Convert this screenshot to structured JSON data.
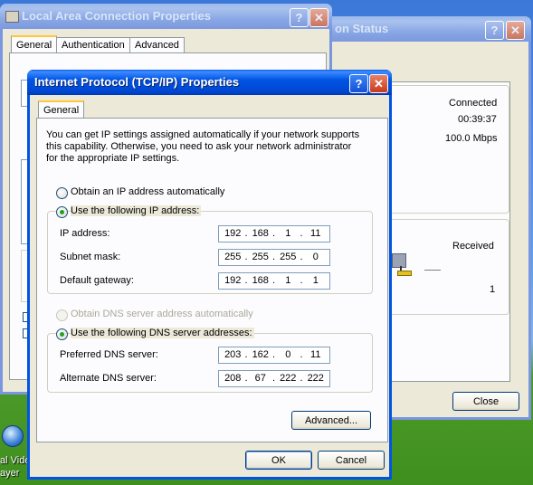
{
  "desktop": {
    "icon_label_1": "al Video",
    "icon_label_2": "ayer"
  },
  "status_window": {
    "title": "on Status",
    "help": "?",
    "close": "✕",
    "connected": "Connected",
    "duration": "00:39:37",
    "speed": "100.0 Mbps",
    "received_label": "Received",
    "received_count": "1",
    "close_button": "Close"
  },
  "lan_window": {
    "title": "Local Area Connection Properties",
    "help": "?",
    "close": "✕",
    "tabs": [
      "General",
      "Authentication",
      "Advanced"
    ]
  },
  "tcp_dialog": {
    "title": "Internet Protocol (TCP/IP) Properties",
    "help": "?",
    "close": "✕",
    "tab": "General",
    "intro": "You can get IP settings assigned automatically if your network supports this capability. Otherwise, you need to ask your network administrator for the appropriate IP settings.",
    "radio_auto_ip": "Obtain an IP address automatically",
    "radio_static_ip": "Use the following IP address:",
    "ip_label": "IP address:",
    "ip": [
      "192",
      "168",
      "1",
      "11"
    ],
    "mask_label": "Subnet mask:",
    "mask": [
      "255",
      "255",
      "255",
      "0"
    ],
    "gw_label": "Default gateway:",
    "gw": [
      "192",
      "168",
      "1",
      "1"
    ],
    "radio_auto_dns": "Obtain DNS server address automatically",
    "radio_static_dns": "Use the following DNS server addresses:",
    "dns1_label": "Preferred DNS server:",
    "dns1": [
      "203",
      "162",
      "0",
      "11"
    ],
    "dns2_label": "Alternate DNS server:",
    "dns2": [
      "208",
      "67",
      "222",
      "222"
    ],
    "advanced": "Advanced...",
    "ok": "OK",
    "cancel": "Cancel"
  }
}
